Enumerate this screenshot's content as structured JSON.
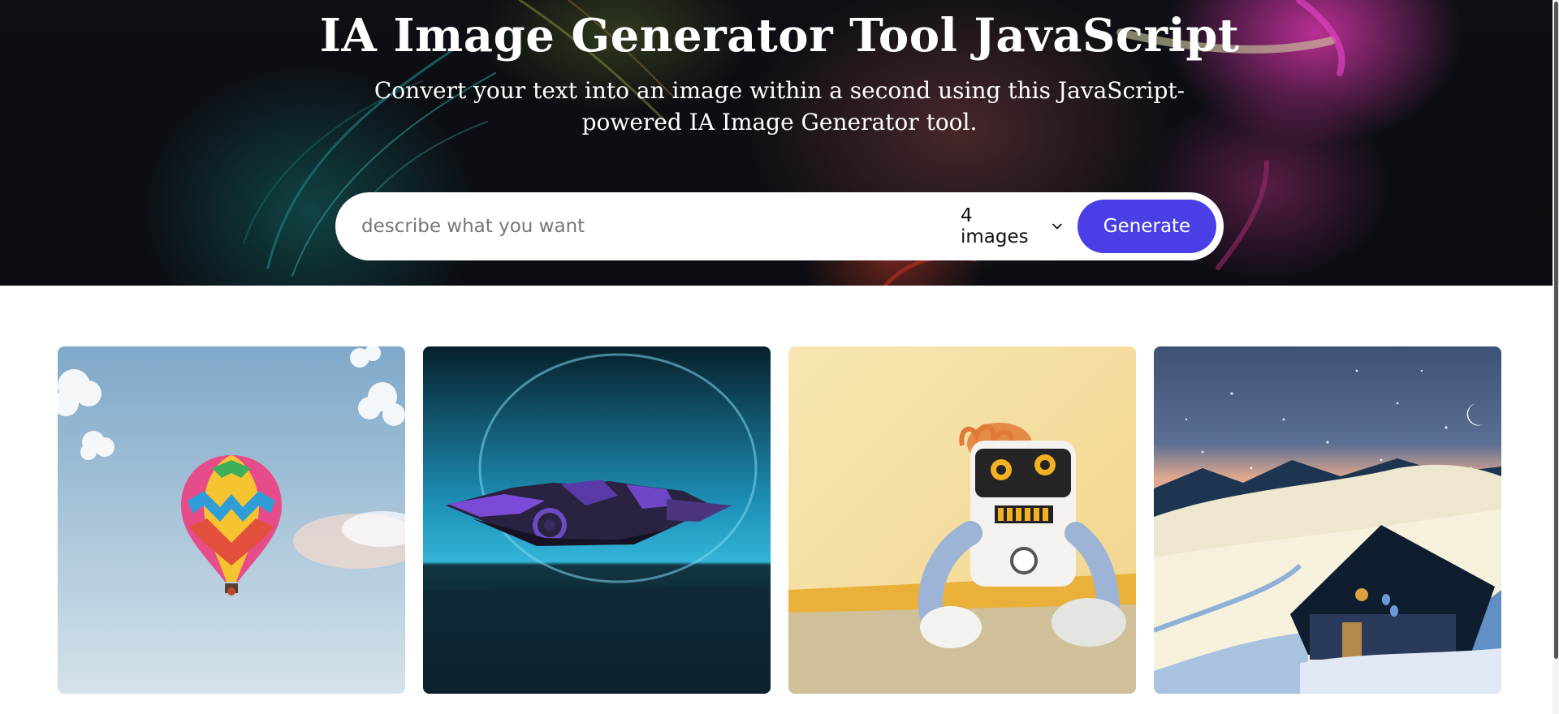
{
  "hero": {
    "title": "IA Image Generator Tool JavaScript",
    "subtitle": "Convert your text into an image within a second using this JavaScript-powered IA Image Generator tool.",
    "background_icon": "neon-face-artwork"
  },
  "search": {
    "placeholder": "describe what you want",
    "value": "",
    "count_selected": "4 images",
    "generate_label": "Generate",
    "accent_color": "#4a3fe6"
  },
  "gallery": {
    "images": [
      {
        "icon": "hot-air-balloon-image"
      },
      {
        "icon": "spaceship-image"
      },
      {
        "icon": "plush-robot-image"
      },
      {
        "icon": "snowy-cabin-night-image"
      }
    ]
  }
}
